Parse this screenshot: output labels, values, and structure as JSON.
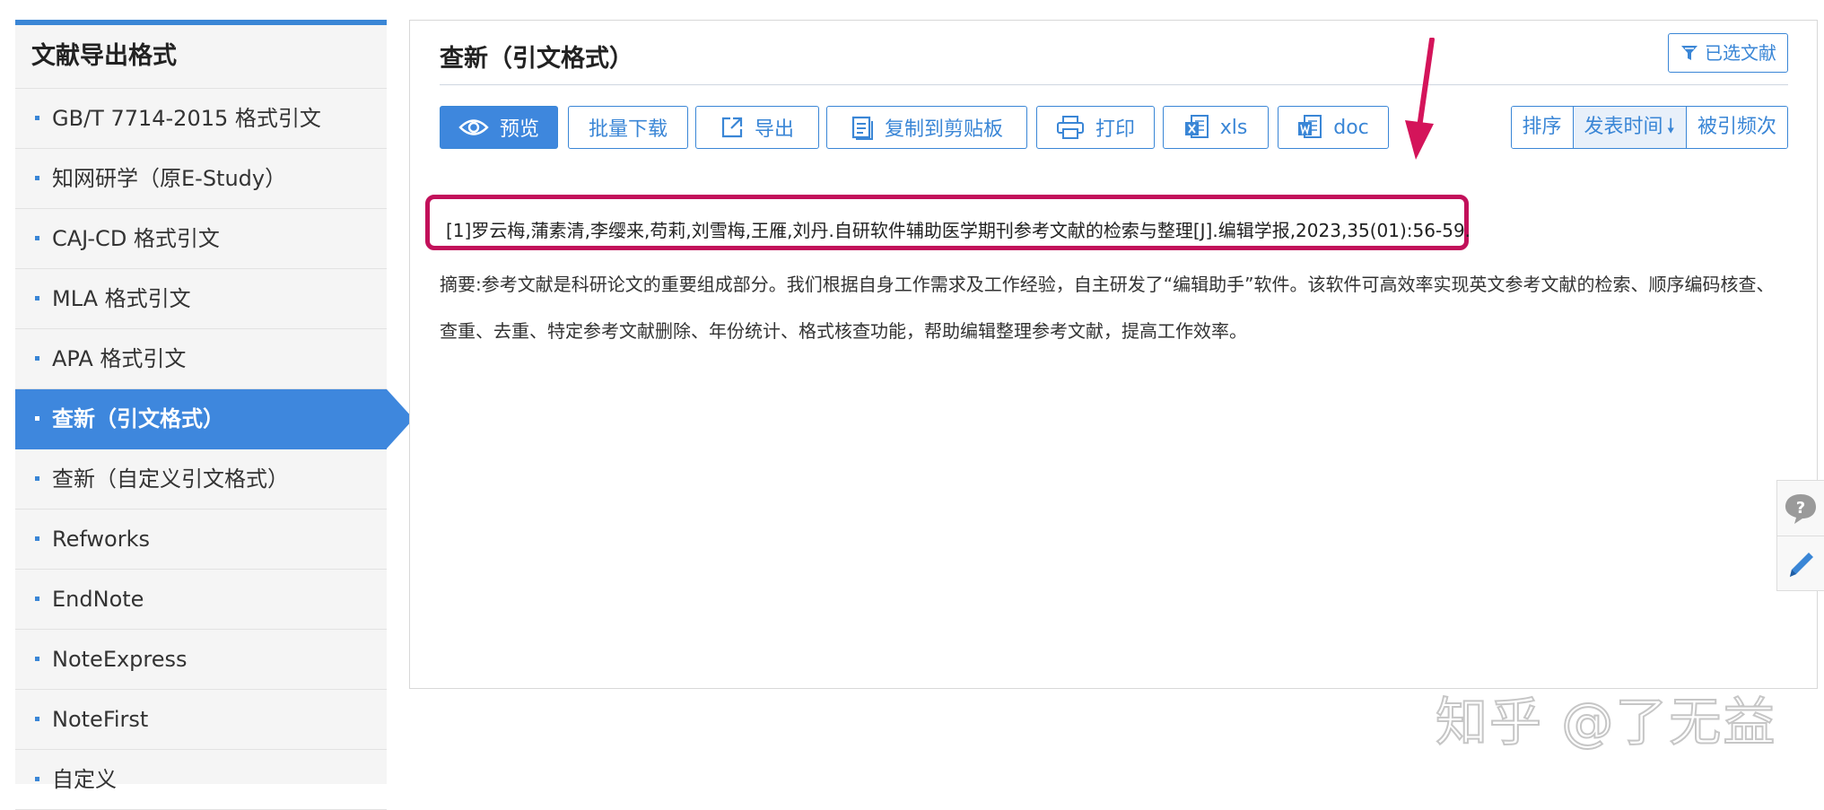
{
  "sidebar": {
    "title": "文献导出格式",
    "items": [
      {
        "label": "GB/T 7714-2015 格式引文"
      },
      {
        "label": "知网研学（原E-Study）"
      },
      {
        "label": "CAJ-CD 格式引文"
      },
      {
        "label": "MLA 格式引文"
      },
      {
        "label": "APA 格式引文"
      },
      {
        "label": "查新（引文格式）",
        "active": true
      },
      {
        "label": "查新（自定义引文格式）"
      },
      {
        "label": "Refworks"
      },
      {
        "label": "EndNote"
      },
      {
        "label": "NoteExpress"
      },
      {
        "label": "NoteFirst"
      },
      {
        "label": "自定义"
      }
    ]
  },
  "main": {
    "title": "查新（引文格式）",
    "selected_button": "已选文献",
    "toolbar": {
      "preview": "预览",
      "batch_download": "批量下载",
      "export": "导出",
      "copy": "复制到剪贴板",
      "print": "打印",
      "xls": "xls",
      "doc": "doc"
    },
    "sort": {
      "label": "排序",
      "by_date": "发表时间",
      "by_citations": "被引频次"
    },
    "citation": "[1]罗云梅,蒲素清,李缨来,苟莉,刘雪梅,王雁,刘丹.自研软件辅助医学期刊参考文献的检索与整理[J].编辑学报,2023,35(01):56-59.",
    "abstract_line1": "摘要:参考文献是科研论文的重要组成部分。我们根据自身工作需求及工作经验，自主研发了“编辑助手”软件。该软件可高效率实现英文参考文献的检索、顺序编码核查、",
    "abstract_line2": "查重、去重、特定参考文献删除、年份统计、格式核查功能，帮助编辑整理参考文献，提高工作效率。"
  },
  "watermark": "知乎 @了无益",
  "colors": {
    "accent": "#3a86d6",
    "active_bg": "#3e87dd",
    "highlight": "#c2105a"
  }
}
